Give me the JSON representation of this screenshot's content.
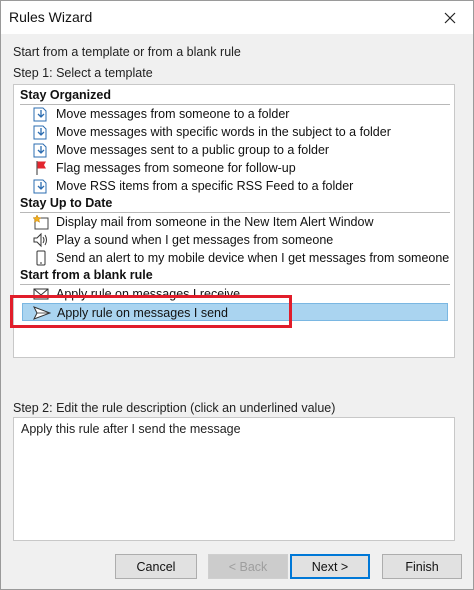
{
  "window": {
    "title": "Rules Wizard"
  },
  "intro": "Start from a template or from a blank rule",
  "step1": "Step 1: Select a template",
  "groups": [
    {
      "header": "Stay Organized",
      "items": [
        {
          "label": "Move messages from someone to a folder",
          "icon": "move-to-folder-icon"
        },
        {
          "label": "Move messages with specific words in the subject to a folder",
          "icon": "move-to-folder-icon"
        },
        {
          "label": "Move messages sent to a public group to a folder",
          "icon": "move-to-folder-icon"
        },
        {
          "label": "Flag messages from someone for follow-up",
          "icon": "red-flag-icon"
        },
        {
          "label": "Move RSS items from a specific RSS Feed to a folder",
          "icon": "move-to-folder-icon"
        }
      ]
    },
    {
      "header": "Stay Up to Date",
      "items": [
        {
          "label": "Display mail from someone in the New Item Alert Window",
          "icon": "new-item-alert-icon"
        },
        {
          "label": "Play a sound when I get messages from someone",
          "icon": "speaker-icon"
        },
        {
          "label": "Send an alert to my mobile device when I get messages from someone",
          "icon": "mobile-device-icon"
        }
      ]
    },
    {
      "header": "Start from a blank rule",
      "items": [
        {
          "label": "Apply rule on messages I receive",
          "icon": "envelope-icon"
        },
        {
          "label": "Apply rule on messages I send",
          "icon": "send-arrow-icon",
          "selected": true
        }
      ]
    }
  ],
  "step2": "Step 2: Edit the rule description (click an underlined value)",
  "description": "Apply this rule after I send the message",
  "buttons": {
    "cancel": "Cancel",
    "back": "< Back",
    "next": "Next >",
    "finish": "Finish"
  },
  "colors": {
    "selection": "#aad4f0",
    "highlight_box": "#e11d2a",
    "flag": "#e3262f",
    "icon_blue": "#2b6cb0"
  }
}
